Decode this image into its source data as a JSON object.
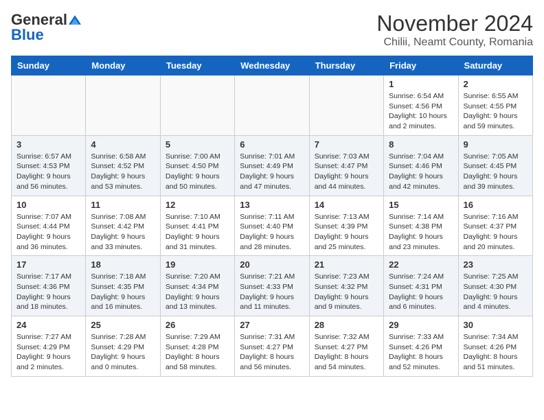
{
  "logo": {
    "general": "General",
    "blue": "Blue"
  },
  "title": "November 2024",
  "subtitle": "Chilii, Neamt County, Romania",
  "weekdays": [
    "Sunday",
    "Monday",
    "Tuesday",
    "Wednesday",
    "Thursday",
    "Friday",
    "Saturday"
  ],
  "weeks": [
    [
      {
        "day": "",
        "info": ""
      },
      {
        "day": "",
        "info": ""
      },
      {
        "day": "",
        "info": ""
      },
      {
        "day": "",
        "info": ""
      },
      {
        "day": "",
        "info": ""
      },
      {
        "day": "1",
        "info": "Sunrise: 6:54 AM\nSunset: 4:56 PM\nDaylight: 10 hours and 2 minutes."
      },
      {
        "day": "2",
        "info": "Sunrise: 6:55 AM\nSunset: 4:55 PM\nDaylight: 9 hours and 59 minutes."
      }
    ],
    [
      {
        "day": "3",
        "info": "Sunrise: 6:57 AM\nSunset: 4:53 PM\nDaylight: 9 hours and 56 minutes."
      },
      {
        "day": "4",
        "info": "Sunrise: 6:58 AM\nSunset: 4:52 PM\nDaylight: 9 hours and 53 minutes."
      },
      {
        "day": "5",
        "info": "Sunrise: 7:00 AM\nSunset: 4:50 PM\nDaylight: 9 hours and 50 minutes."
      },
      {
        "day": "6",
        "info": "Sunrise: 7:01 AM\nSunset: 4:49 PM\nDaylight: 9 hours and 47 minutes."
      },
      {
        "day": "7",
        "info": "Sunrise: 7:03 AM\nSunset: 4:47 PM\nDaylight: 9 hours and 44 minutes."
      },
      {
        "day": "8",
        "info": "Sunrise: 7:04 AM\nSunset: 4:46 PM\nDaylight: 9 hours and 42 minutes."
      },
      {
        "day": "9",
        "info": "Sunrise: 7:05 AM\nSunset: 4:45 PM\nDaylight: 9 hours and 39 minutes."
      }
    ],
    [
      {
        "day": "10",
        "info": "Sunrise: 7:07 AM\nSunset: 4:44 PM\nDaylight: 9 hours and 36 minutes."
      },
      {
        "day": "11",
        "info": "Sunrise: 7:08 AM\nSunset: 4:42 PM\nDaylight: 9 hours and 33 minutes."
      },
      {
        "day": "12",
        "info": "Sunrise: 7:10 AM\nSunset: 4:41 PM\nDaylight: 9 hours and 31 minutes."
      },
      {
        "day": "13",
        "info": "Sunrise: 7:11 AM\nSunset: 4:40 PM\nDaylight: 9 hours and 28 minutes."
      },
      {
        "day": "14",
        "info": "Sunrise: 7:13 AM\nSunset: 4:39 PM\nDaylight: 9 hours and 25 minutes."
      },
      {
        "day": "15",
        "info": "Sunrise: 7:14 AM\nSunset: 4:38 PM\nDaylight: 9 hours and 23 minutes."
      },
      {
        "day": "16",
        "info": "Sunrise: 7:16 AM\nSunset: 4:37 PM\nDaylight: 9 hours and 20 minutes."
      }
    ],
    [
      {
        "day": "17",
        "info": "Sunrise: 7:17 AM\nSunset: 4:36 PM\nDaylight: 9 hours and 18 minutes."
      },
      {
        "day": "18",
        "info": "Sunrise: 7:18 AM\nSunset: 4:35 PM\nDaylight: 9 hours and 16 minutes."
      },
      {
        "day": "19",
        "info": "Sunrise: 7:20 AM\nSunset: 4:34 PM\nDaylight: 9 hours and 13 minutes."
      },
      {
        "day": "20",
        "info": "Sunrise: 7:21 AM\nSunset: 4:33 PM\nDaylight: 9 hours and 11 minutes."
      },
      {
        "day": "21",
        "info": "Sunrise: 7:23 AM\nSunset: 4:32 PM\nDaylight: 9 hours and 9 minutes."
      },
      {
        "day": "22",
        "info": "Sunrise: 7:24 AM\nSunset: 4:31 PM\nDaylight: 9 hours and 6 minutes."
      },
      {
        "day": "23",
        "info": "Sunrise: 7:25 AM\nSunset: 4:30 PM\nDaylight: 9 hours and 4 minutes."
      }
    ],
    [
      {
        "day": "24",
        "info": "Sunrise: 7:27 AM\nSunset: 4:29 PM\nDaylight: 9 hours and 2 minutes."
      },
      {
        "day": "25",
        "info": "Sunrise: 7:28 AM\nSunset: 4:29 PM\nDaylight: 9 hours and 0 minutes."
      },
      {
        "day": "26",
        "info": "Sunrise: 7:29 AM\nSunset: 4:28 PM\nDaylight: 8 hours and 58 minutes."
      },
      {
        "day": "27",
        "info": "Sunrise: 7:31 AM\nSunset: 4:27 PM\nDaylight: 8 hours and 56 minutes."
      },
      {
        "day": "28",
        "info": "Sunrise: 7:32 AM\nSunset: 4:27 PM\nDaylight: 8 hours and 54 minutes."
      },
      {
        "day": "29",
        "info": "Sunrise: 7:33 AM\nSunset: 4:26 PM\nDaylight: 8 hours and 52 minutes."
      },
      {
        "day": "30",
        "info": "Sunrise: 7:34 AM\nSunset: 4:26 PM\nDaylight: 8 hours and 51 minutes."
      }
    ]
  ]
}
